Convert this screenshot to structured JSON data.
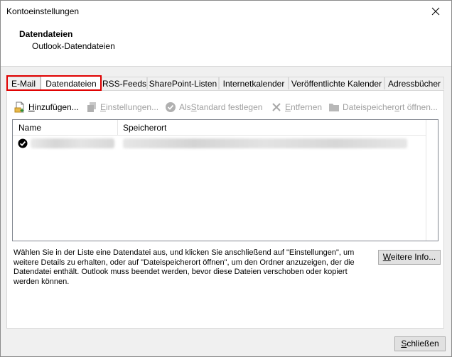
{
  "window": {
    "title": "Kontoeinstellungen"
  },
  "header": {
    "title": "Datendateien",
    "subtitle": "Outlook-Datendateien"
  },
  "tabs": [
    {
      "label": "E-Mail"
    },
    {
      "label": "Datendateien"
    },
    {
      "label": "RSS-Feeds"
    },
    {
      "label": "SharePoint-Listen"
    },
    {
      "label": "Internetkalender"
    },
    {
      "label": "Veröffentlichte Kalender"
    },
    {
      "label": "Adressbücher"
    }
  ],
  "active_tab": "Datendateien",
  "toolbar": {
    "add": {
      "pre": "",
      "key": "H",
      "post": "inzufügen..."
    },
    "settings": {
      "pre": "",
      "key": "E",
      "post": "instellungen..."
    },
    "default": {
      "pre": "Als ",
      "key": "S",
      "post": "tandard festlegen"
    },
    "remove": {
      "pre": "",
      "key": "E",
      "post": "ntfernen"
    },
    "open": {
      "pre": "Dateispeicher",
      "key": "o",
      "post": "rt öffnen..."
    }
  },
  "list": {
    "columns": {
      "name": "Name",
      "location": "Speicherort"
    },
    "rows": [
      {
        "name": "",
        "location": ""
      }
    ]
  },
  "info_text": "Wählen Sie in der Liste eine Datendatei aus, und klicken Sie anschließend auf \"Einstellungen\", um weitere Details zu erhalten, oder auf \"Dateispeicherort öffnen\", um den Ordner anzuzeigen, der die Datendatei enthält. Outlook muss beendet werden, bevor diese Dateien verschoben oder kopiert werden können.",
  "buttons": {
    "more": {
      "key": "W",
      "post": "eitere Info..."
    },
    "close": {
      "key": "S",
      "post": "chließen"
    }
  },
  "colors": {
    "highlight": "#e00000",
    "panel": "#ffffff",
    "dialog": "#f0f0f0"
  }
}
